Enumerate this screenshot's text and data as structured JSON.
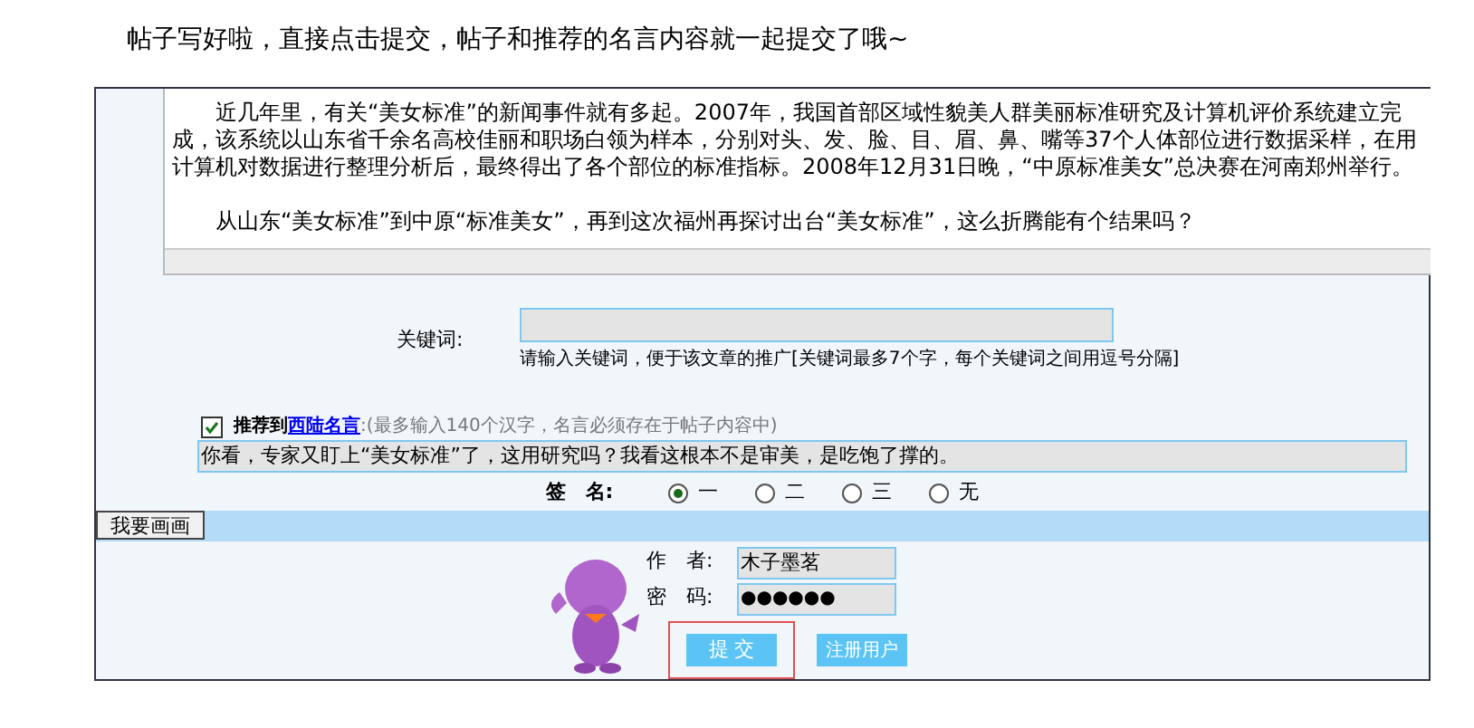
{
  "header": "帖子写好啦，直接点击提交，帖子和推荐的名言内容就一起提交了哦~",
  "article": {
    "paragraphs": [
      "近几年里，有关“美女标准”的新闻事件就有多起。2007年，我国首部区域性貌美人群美丽标准研究及计算机评价系统建立完成，该系统以山东省千余名高校佳丽和职场白领为样本，分别对头、发、脸、目、眉、鼻、嘴等37个人体部位进行数据采样，在用计算机对数据进行整理分析后，最终得出了各个部位的标准指标。2008年12月31日晚，“中原标准美女”总决赛在河南郑州举行。",
      "从山东“美女标准”到中原“标准美女”，再到这次福州再探讨出台“美女标准”，这么折腾能有个结果吗？"
    ]
  },
  "keyword": {
    "label": "关键词:",
    "hint": "请输入关键词，便于该文章的推广[关键词最多7个字，每个关键词之间用逗号分隔]"
  },
  "recommend": {
    "checked": true,
    "prefix": "推荐到",
    "link": "西陆名言",
    "note": ":(最多输入140个汉字，名言必须存在于帖子内容中)",
    "value": "你看，专家又盯上“美女标准”了，这用研究吗？我看这根本不是审美，是吃饱了撑的。"
  },
  "signature": {
    "label": "签　名:",
    "options": [
      {
        "label": "一",
        "selected": true
      },
      {
        "label": "二",
        "selected": false
      },
      {
        "label": "三",
        "selected": false
      },
      {
        "label": "无",
        "selected": false
      }
    ]
  },
  "draw_button": "我要画画",
  "author": {
    "label": "作　者:",
    "value": "木子墨茗"
  },
  "password": {
    "label": "密　码:",
    "value": "●●●●●●"
  },
  "submit": "提 交",
  "register": "注册用户"
}
